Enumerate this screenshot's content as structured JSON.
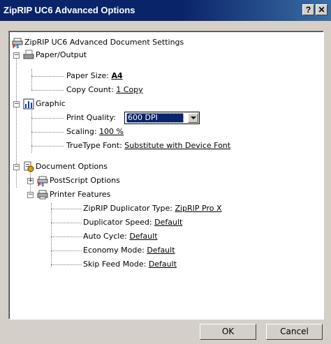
{
  "window": {
    "title": "ZipRIP UC6 Advanced Options",
    "help_glyph": "?",
    "close_glyph": "✕"
  },
  "tree": {
    "root": {
      "label": "ZipRIP UC6 Advanced Document Settings",
      "icon": "printer-ps-icon"
    },
    "paper_output": {
      "label": "Paper/Output",
      "icon": "paper-output-icon",
      "expander": "−",
      "paper_size": {
        "label": "Paper Size:",
        "value": "A4"
      },
      "copy_count": {
        "label": "Copy Count:",
        "value": "1 Copy"
      }
    },
    "graphic": {
      "label": "Graphic",
      "icon": "graphic-chart-icon",
      "expander": "−",
      "print_quality": {
        "label": "Print Quality:",
        "value": "600 DPI"
      },
      "scaling": {
        "label": "Scaling:",
        "value": "100 %"
      },
      "truetype_font": {
        "label": "TrueType Font:",
        "value": "Substitute with Device Font"
      }
    },
    "document_options": {
      "label": "Document Options",
      "icon": "document-options-icon",
      "expander": "−",
      "postscript_options": {
        "label": "PostScript Options",
        "icon": "postscript-icon",
        "expander": "+"
      },
      "printer_features": {
        "label": "Printer Features",
        "icon": "printer-features-icon",
        "expander": "−",
        "duplicator_type": {
          "label": "ZipRIP Duplicator Type:",
          "value": "ZipRIP Pro X"
        },
        "duplicator_speed": {
          "label": "Duplicator Speed:",
          "value": "Default"
        },
        "auto_cycle": {
          "label": "Auto Cycle:",
          "value": "Default"
        },
        "economy_mode": {
          "label": "Economy Mode:",
          "value": "Default"
        },
        "skip_feed_mode": {
          "label": "Skip Feed Mode:",
          "value": "Default"
        }
      }
    }
  },
  "buttons": {
    "ok": "OK",
    "cancel": "Cancel"
  }
}
